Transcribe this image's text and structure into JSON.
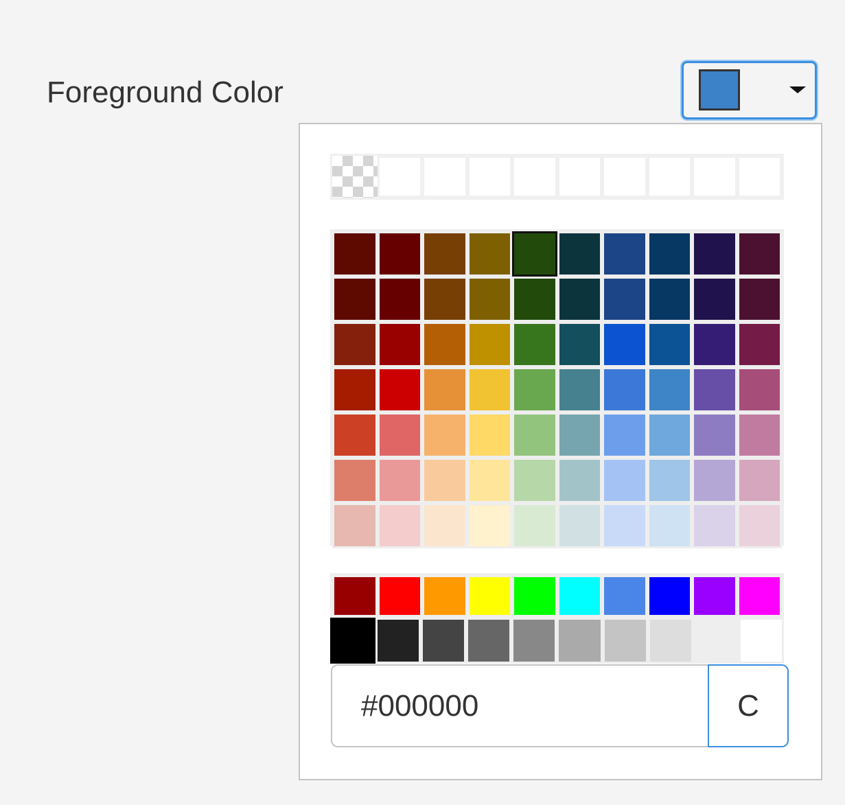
{
  "label": "Foreground Color",
  "picker": {
    "current_color": "#3b82c8",
    "caret_icon": "chevron-down-icon"
  },
  "recent_colors": [
    "transparent",
    "#ffffff",
    "#ffffff",
    "#ffffff",
    "#ffffff",
    "#ffffff",
    "#ffffff",
    "#ffffff",
    "#ffffff",
    "#ffffff"
  ],
  "palette": [
    [
      "#5e0a00",
      "#660000",
      "#783f04",
      "#7f6000",
      "#214a0b",
      "#0c343d",
      "#1c4587",
      "#073763",
      "#20124d",
      "#4c1130"
    ],
    [
      "#5e0a00",
      "#660000",
      "#783f04",
      "#7f6000",
      "#214a0b",
      "#0c343d",
      "#1c4587",
      "#073763",
      "#20124d",
      "#4c1130"
    ],
    [
      "#85200c",
      "#990000",
      "#b45f06",
      "#bf9000",
      "#38761d",
      "#134f5c",
      "#0b53d0",
      "#0b5394",
      "#351c75",
      "#741b47"
    ],
    [
      "#a61c00",
      "#cc0000",
      "#e69138",
      "#f1c232",
      "#6aa84f",
      "#45818e",
      "#3c78d8",
      "#3d85c6",
      "#674ea7",
      "#a64d79"
    ],
    [
      "#cc4125",
      "#e06666",
      "#f6b26b",
      "#ffd966",
      "#93c47d",
      "#76a5af",
      "#6d9eeb",
      "#6fa8dc",
      "#8e7cc3",
      "#c27ba0"
    ],
    [
      "#dd7e6b",
      "#ea9999",
      "#f9cb9c",
      "#ffe599",
      "#b6d7a8",
      "#a2c4c9",
      "#a4c2f4",
      "#9fc5e8",
      "#b4a7d6",
      "#d5a6bd"
    ],
    [
      "#e6b8af",
      "#f4cccc",
      "#fce5cd",
      "#fff2cc",
      "#d9ead3",
      "#d0e0e3",
      "#c9daf8",
      "#cfe2f3",
      "#d9d2e9",
      "#ead1dc"
    ]
  ],
  "palette_selected": {
    "row": 0,
    "col": 4
  },
  "standard_colors": [
    "#980000",
    "#ff0000",
    "#ff9900",
    "#ffff00",
    "#00ff00",
    "#00ffff",
    "#4a86e8",
    "#0000ff",
    "#9900ff",
    "#ff00ff"
  ],
  "gray_colors": [
    "#000000",
    "#222222",
    "#444444",
    "#666666",
    "#888888",
    "#aaaaaa",
    "#c4c4c4",
    "#dddddd",
    "#eeeeee",
    "#ffffff"
  ],
  "gray_selected": 0,
  "hex_input": {
    "value": "#000000"
  },
  "hex_button_label": "C"
}
